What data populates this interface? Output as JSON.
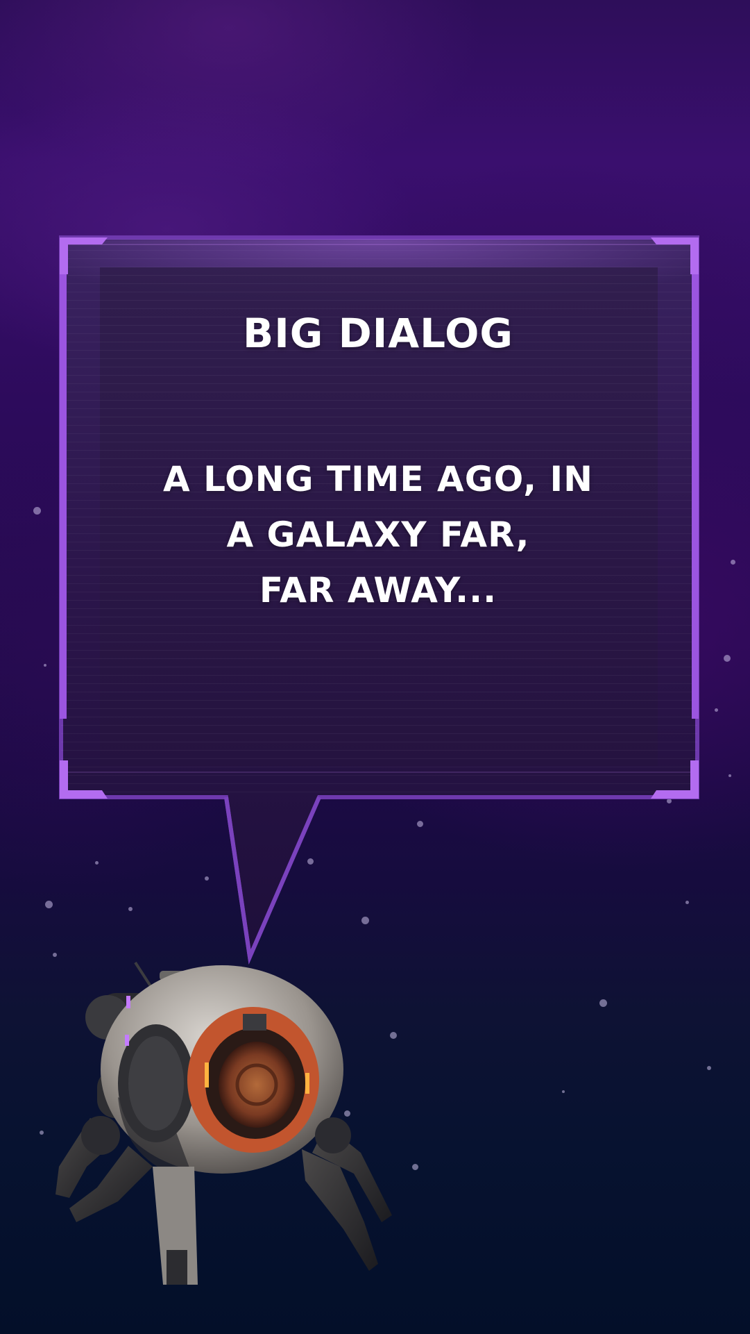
{
  "dialog": {
    "title": "BIG DIALOG",
    "body_lines": [
      "A LONG TIME AGO, IN",
      "A GALAXY FAR,",
      "FAR AWAY..."
    ]
  },
  "colors": {
    "frame_accent": "#9b55e0",
    "panel_fill": "#2a1545",
    "background_top": "#2e0e5a",
    "background_bottom": "#030f29",
    "text": "#ffffff"
  },
  "icons": {
    "character": "robot-spider-icon"
  }
}
